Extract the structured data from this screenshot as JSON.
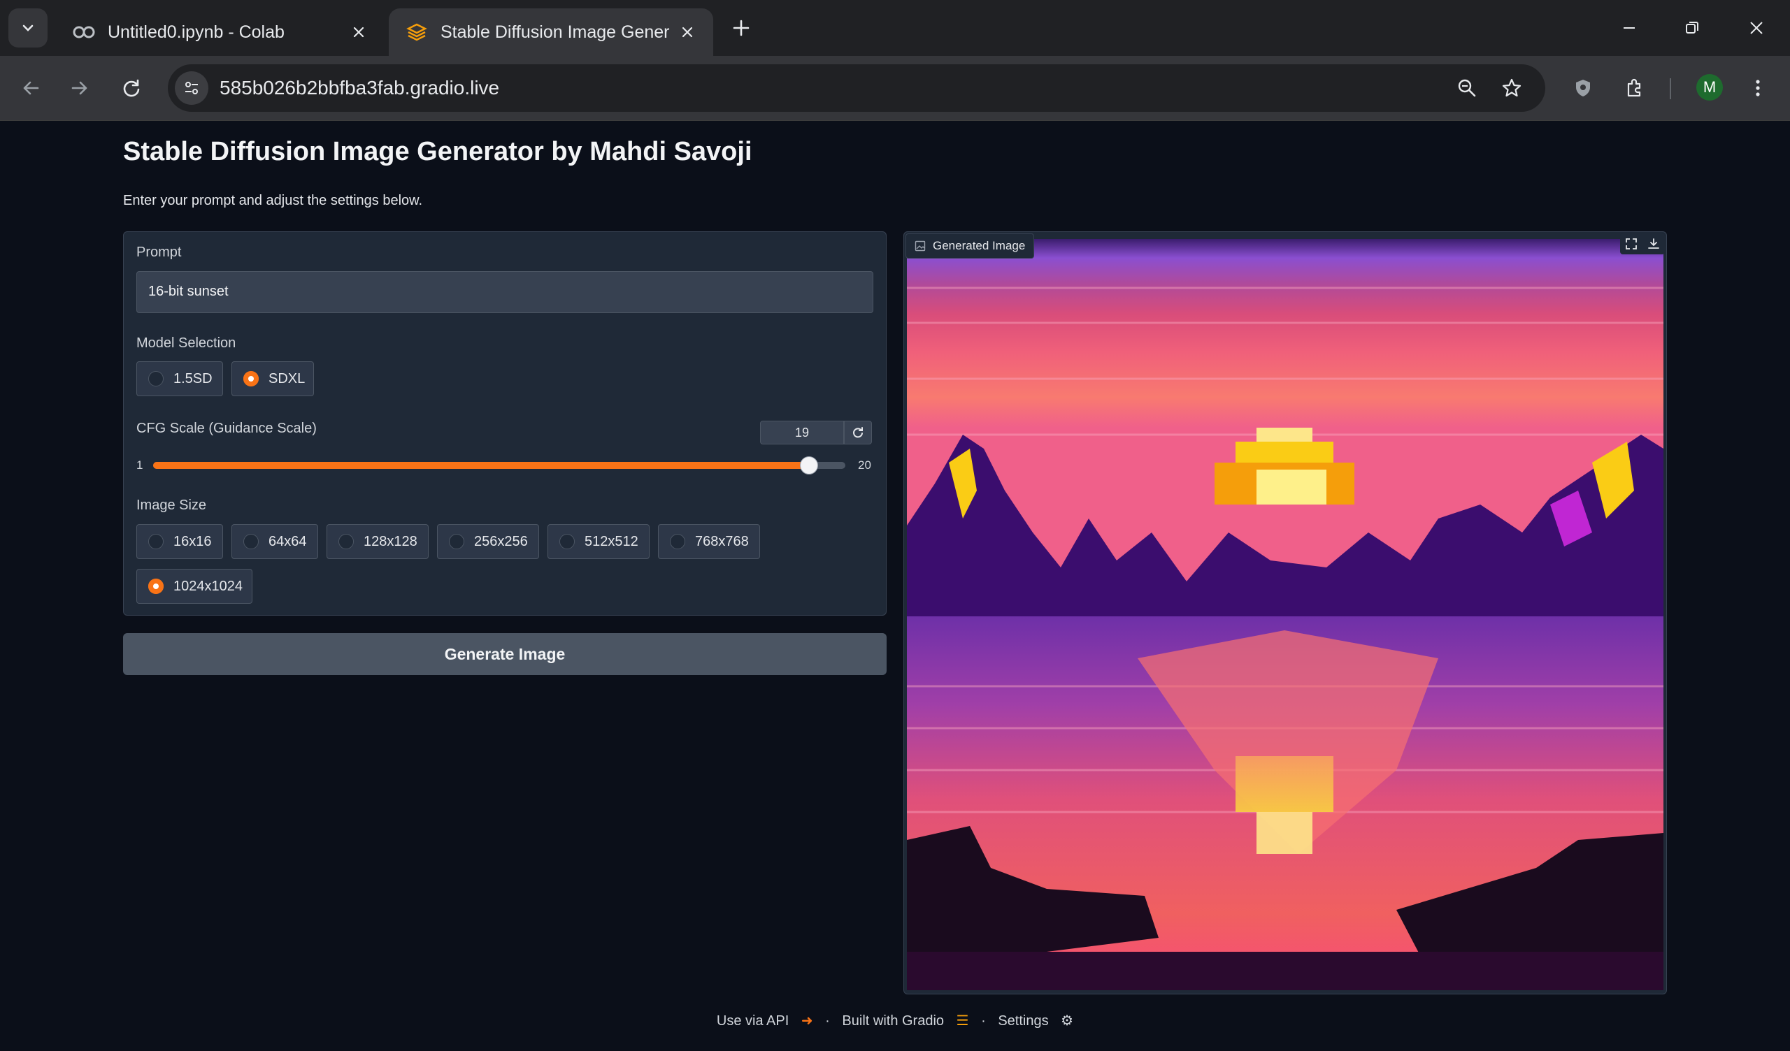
{
  "browser": {
    "tabs": [
      {
        "title": "Untitled0.ipynb - Colab",
        "icon": "colab-icon",
        "active": false
      },
      {
        "title": "Stable Diffusion Image Generator",
        "icon": "gradio-icon",
        "active": true
      }
    ],
    "url": "585b026b2bbfba3fab.gradio.live",
    "profile_initial": "M"
  },
  "page": {
    "title": "Stable Diffusion Image Generator by Mahdi Savoji",
    "subtitle": "Enter your prompt and adjust the settings below."
  },
  "prompt": {
    "label": "Prompt",
    "value": "16-bit sunset"
  },
  "model": {
    "label": "Model Selection",
    "options": [
      "1.5SD",
      "SDXL"
    ],
    "selected": "SDXL"
  },
  "cfg": {
    "label": "CFG Scale (Guidance Scale)",
    "value": "19",
    "min": "1",
    "max": "20",
    "level": 0.947
  },
  "size": {
    "label": "Image Size",
    "options": [
      "16x16",
      "64x64",
      "128x128",
      "256x256",
      "512x512",
      "768x768",
      "1024x1024"
    ],
    "selected": "1024x1024"
  },
  "generate_label": "Generate Image",
  "output": {
    "label": "Generated Image"
  },
  "footer": {
    "api": "Use via API",
    "built": "Built with Gradio",
    "settings": "Settings",
    "sep": "·"
  },
  "colors": {
    "accent": "#f97316",
    "background": "#0b0f19",
    "panel": "#1f2937"
  }
}
